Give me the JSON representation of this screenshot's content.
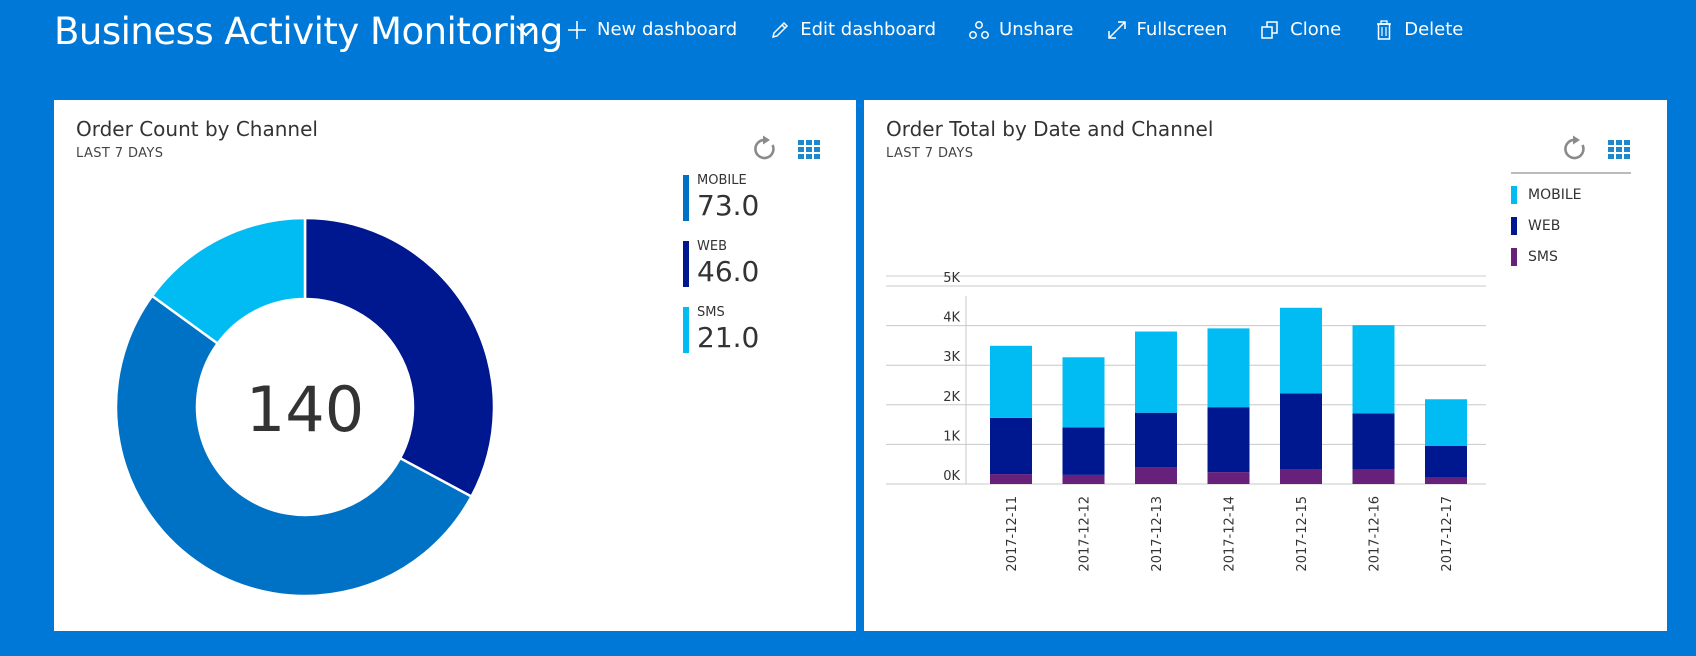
{
  "header": {
    "title": "Business Activity Monitoring",
    "toolbar": [
      {
        "label": "New dashboard",
        "icon": "plus-icon"
      },
      {
        "label": "Edit dashboard",
        "icon": "pencil-icon"
      },
      {
        "label": "Unshare",
        "icon": "unshare-icon"
      },
      {
        "label": "Fullscreen",
        "icon": "fullscreen-icon"
      },
      {
        "label": "Clone",
        "icon": "clone-icon"
      },
      {
        "label": "Delete",
        "icon": "trash-icon"
      }
    ]
  },
  "colors": {
    "background": "#0078d7",
    "mobile": "#0072c6",
    "web": "#00188f",
    "sms": "#00bcf2",
    "bar_mobile": "#00bcf2",
    "bar_web": "#00188f",
    "bar_sms": "#68217a"
  },
  "panels": {
    "left": {
      "title": "Order Count by Channel",
      "subtitle": "LAST 7 DAYS",
      "actions": [
        "refresh-icon",
        "grid-view-icon"
      ],
      "center_value": "140",
      "legend": [
        {
          "label": "MOBILE",
          "value": "73.0"
        },
        {
          "label": "WEB",
          "value": "46.0"
        },
        {
          "label": "SMS",
          "value": "21.0"
        }
      ]
    },
    "right": {
      "title": "Order Total by Date and Channel",
      "subtitle": "LAST 7 DAYS",
      "actions": [
        "refresh-icon",
        "grid-view-icon"
      ],
      "legend": [
        {
          "label": "MOBILE"
        },
        {
          "label": "WEB"
        },
        {
          "label": "SMS"
        }
      ]
    }
  },
  "chart_data": [
    {
      "type": "pie",
      "title": "Order Count by Channel",
      "subtitle": "LAST 7 DAYS",
      "categories": [
        "MOBILE",
        "WEB",
        "SMS"
      ],
      "values": [
        73,
        46,
        21
      ],
      "total": 140,
      "legend": "right"
    },
    {
      "type": "bar",
      "stacked": true,
      "title": "Order Total by Date and Channel",
      "subtitle": "LAST 7 DAYS",
      "categories": [
        "2017-12-11",
        "2017-12-12",
        "2017-12-13",
        "2017-12-14",
        "2017-12-15",
        "2017-12-16",
        "2017-12-17"
      ],
      "series": [
        {
          "name": "SMS",
          "values": [
            250,
            230,
            420,
            300,
            360,
            360,
            160
          ]
        },
        {
          "name": "WEB",
          "values": [
            1420,
            1200,
            1380,
            1640,
            1930,
            1420,
            800
          ]
        },
        {
          "name": "MOBILE",
          "values": [
            1820,
            1770,
            2050,
            1990,
            2160,
            2230,
            1180
          ]
        }
      ],
      "ylim": [
        0,
        5000
      ],
      "yticks": [
        "0K",
        "1K",
        "2K",
        "3K",
        "4K",
        "5K"
      ],
      "grid": true,
      "legend": "top-right"
    }
  ]
}
